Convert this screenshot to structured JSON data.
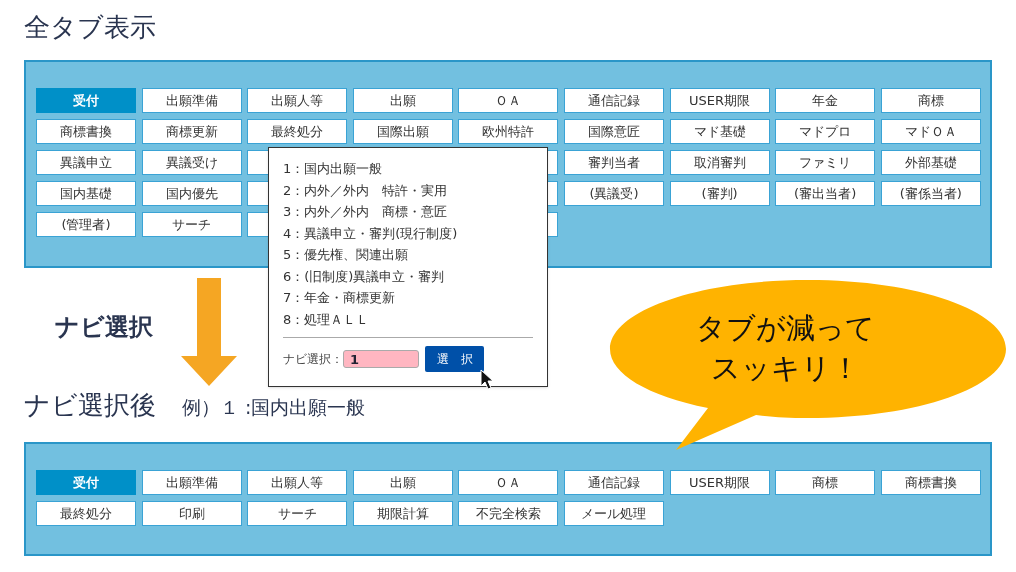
{
  "top_title": "全タブ表示",
  "all_tabs": [
    [
      {
        "kind": "tab",
        "label": "受付",
        "selected": true
      },
      {
        "kind": "tab",
        "label": "出願準備",
        "selected": false
      },
      {
        "kind": "tab",
        "label": "出願人等",
        "selected": false
      },
      {
        "kind": "tab",
        "label": "出願",
        "selected": false
      },
      {
        "kind": "tab",
        "label": "ＯＡ",
        "selected": false
      },
      {
        "kind": "tab",
        "label": "通信記録",
        "selected": false
      },
      {
        "kind": "tab",
        "label": "USER期限",
        "selected": false
      },
      {
        "kind": "tab",
        "label": "年金",
        "selected": false
      },
      {
        "kind": "tab",
        "label": "商標",
        "selected": false
      }
    ],
    [
      {
        "kind": "tab",
        "label": "商標書換",
        "selected": false
      },
      {
        "kind": "tab",
        "label": "商標更新",
        "selected": false
      },
      {
        "kind": "tab",
        "label": "最終処分",
        "selected": false
      },
      {
        "kind": "tab",
        "label": "国際出願",
        "selected": false
      },
      {
        "kind": "tab",
        "label": "欧州特許",
        "selected": false
      },
      {
        "kind": "tab",
        "label": "国際意匠",
        "selected": false
      },
      {
        "kind": "tab",
        "label": "マド基礎",
        "selected": false
      },
      {
        "kind": "tab",
        "label": "マドプロ",
        "selected": false
      },
      {
        "kind": "tab",
        "label": "マドＯＡ",
        "selected": false
      }
    ],
    [
      {
        "kind": "tab",
        "label": "異議申立",
        "selected": false
      },
      {
        "kind": "tab",
        "label": "異議受け",
        "selected": false
      },
      {
        "kind": "covered"
      },
      {
        "kind": "covered"
      },
      {
        "kind": "covered"
      },
      {
        "kind": "tab",
        "label": "審判当者",
        "selected": false
      },
      {
        "kind": "tab",
        "label": "取消審判",
        "selected": false
      },
      {
        "kind": "tab",
        "label": "ファミリ",
        "selected": false
      },
      {
        "kind": "tab",
        "label": "外部基礎",
        "selected": false
      }
    ],
    [
      {
        "kind": "tab",
        "label": "国内基礎",
        "selected": false
      },
      {
        "kind": "tab",
        "label": "国内優先",
        "selected": false
      },
      {
        "kind": "covered"
      },
      {
        "kind": "covered"
      },
      {
        "kind": "covered"
      },
      {
        "kind": "tab",
        "label": "(異議受)",
        "selected": false
      },
      {
        "kind": "tab",
        "label": "(審判)",
        "selected": false
      },
      {
        "kind": "tab",
        "label": "(審出当者)",
        "selected": false
      },
      {
        "kind": "tab",
        "label": "(審係当者)",
        "selected": false
      }
    ],
    [
      {
        "kind": "tab",
        "label": "(管理者)",
        "selected": false
      },
      {
        "kind": "tab",
        "label": "サーチ",
        "selected": false
      },
      {
        "kind": "covered"
      },
      {
        "kind": "covered"
      },
      {
        "kind": "covered"
      }
    ]
  ],
  "nav_popup": {
    "options": [
      "1：国内出願一般",
      "2：内外／外内　特許・実用",
      "3：内外／外内　商標・意匠",
      "4：異議申立・審判(現行制度)",
      "5：優先権、関連出願",
      "6：(旧制度)異議申立・審判",
      "7：年金・商標更新",
      "8：処理ＡＬＬ"
    ],
    "field_label": "ナビ選択：",
    "field_value": "1",
    "button": "選　択"
  },
  "arrow_label": "ナビ選択",
  "callout": [
    "タブが減って",
    "スッキリ！"
  ],
  "after_title": "ナビ選択後",
  "after_example": "例）１ :国内出願一般",
  "after_tabs": [
    [
      {
        "kind": "tab",
        "label": "受付",
        "selected": true
      },
      {
        "kind": "tab",
        "label": "出願準備",
        "selected": false
      },
      {
        "kind": "tab",
        "label": "出願人等",
        "selected": false
      },
      {
        "kind": "tab",
        "label": "出願",
        "selected": false
      },
      {
        "kind": "tab",
        "label": "ＯＡ",
        "selected": false
      },
      {
        "kind": "tab",
        "label": "通信記録",
        "selected": false
      },
      {
        "kind": "tab",
        "label": "USER期限",
        "selected": false
      },
      {
        "kind": "tab",
        "label": "商標",
        "selected": false
      },
      {
        "kind": "tab",
        "label": "商標書換",
        "selected": false
      }
    ],
    [
      {
        "kind": "tab",
        "label": "最終処分",
        "selected": false
      },
      {
        "kind": "tab",
        "label": "印刷",
        "selected": false
      },
      {
        "kind": "tab",
        "label": "サーチ",
        "selected": false
      },
      {
        "kind": "tab",
        "label": "期限計算",
        "selected": false
      },
      {
        "kind": "tab",
        "label": "不完全検索",
        "selected": false
      },
      {
        "kind": "tab",
        "label": "メール処理",
        "selected": false
      }
    ]
  ]
}
